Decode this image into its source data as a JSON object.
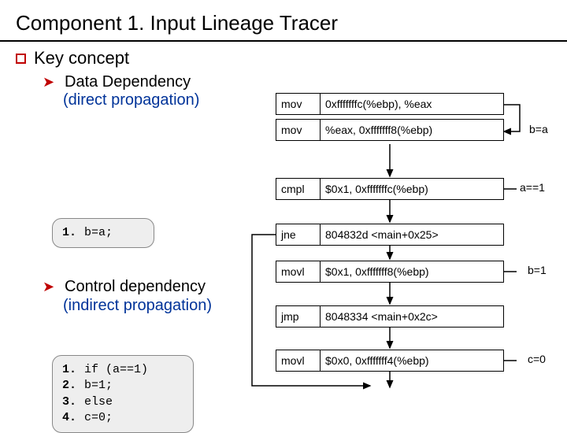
{
  "title": "Component 1. Input Lineage Tracer",
  "key_concept": "Key concept",
  "data_dep": "Data Dependency",
  "direct_prop": "(direct propagation)",
  "control_dep": "Control dependency",
  "indirect_prop": "(indirect propagation)",
  "code1": {
    "lines": [
      {
        "n": "1.",
        "t": "b=a;"
      }
    ]
  },
  "code2": {
    "lines": [
      {
        "n": "1.",
        "t": "if (a==1)"
      },
      {
        "n": "2.",
        "t": "   b=1;"
      },
      {
        "n": "3.",
        "t": "else"
      },
      {
        "n": "4.",
        "t": "   c=0;"
      }
    ]
  },
  "asm": {
    "r1": {
      "op": "mov",
      "arg": "0xfffffffc(%ebp), %eax"
    },
    "r2": {
      "op": "mov",
      "arg": "%eax, 0xfffffff8(%ebp)"
    },
    "r3": {
      "op": "cmpl",
      "arg": "$0x1, 0xfffffffc(%ebp)"
    },
    "r4": {
      "op": "jne",
      "arg": "804832d <main+0x25>"
    },
    "r5": {
      "op": "movl",
      "arg": "$0x1, 0xfffffff8(%ebp)"
    },
    "r6": {
      "op": "jmp",
      "arg": "8048334 <main+0x2c>"
    },
    "r7": {
      "op": "movl",
      "arg": "$0x0, 0xfffffff4(%ebp)"
    }
  },
  "annots": {
    "ba": "b=a",
    "aeq1": "a==1",
    "b1": "b=1",
    "c0": "c=0"
  }
}
